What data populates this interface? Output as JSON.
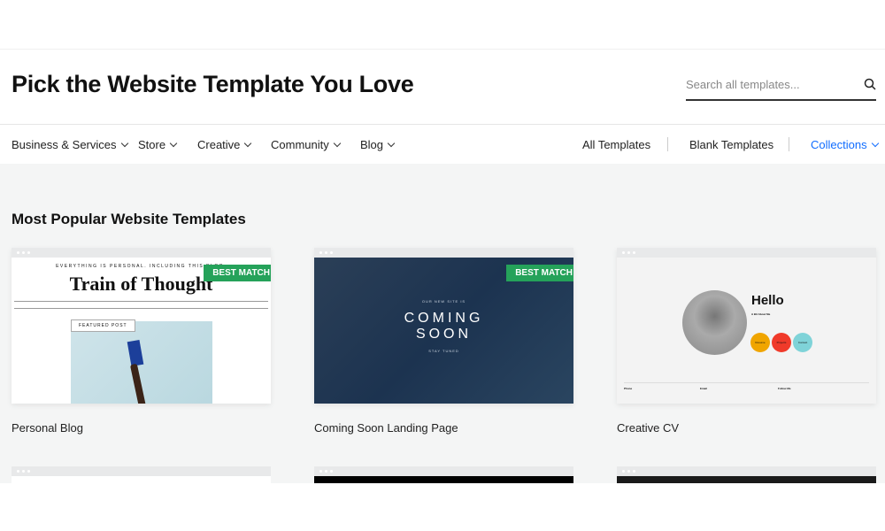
{
  "header": {
    "title": "Pick the Website Template You Love",
    "search_placeholder": "Search all templates..."
  },
  "nav": {
    "left": [
      {
        "label": "Business & Services"
      },
      {
        "label": "Store"
      },
      {
        "label": "Creative"
      },
      {
        "label": "Community"
      },
      {
        "label": "Blog"
      }
    ],
    "all": "All Templates",
    "blank": "Blank Templates",
    "collections": "Collections",
    "collections_color": "#116dff"
  },
  "section_title": "Most Popular Website Templates",
  "templates": [
    {
      "name": "Personal Blog",
      "badge": "BEST MATCH",
      "tagline": "EVERYTHING IS PERSONAL. INCLUDING THIS BLOG.",
      "heading": "Train of Thought",
      "featured": "FEATURED POST"
    },
    {
      "name": "Coming Soon Landing Page",
      "badge": "BEST MATCH",
      "subtitle": "OUR NEW SITE IS",
      "heading1": "COMING",
      "heading2": "SOON",
      "footer": "STAY TUNED"
    },
    {
      "name": "Creative CV",
      "heading": "Hello",
      "sub": "A Bit About Me",
      "buttons": [
        "Resume",
        "Projects",
        "Contact"
      ],
      "footer": [
        "Phone",
        "Email",
        "Follow Me"
      ]
    }
  ],
  "badge_color": "#25a25a"
}
